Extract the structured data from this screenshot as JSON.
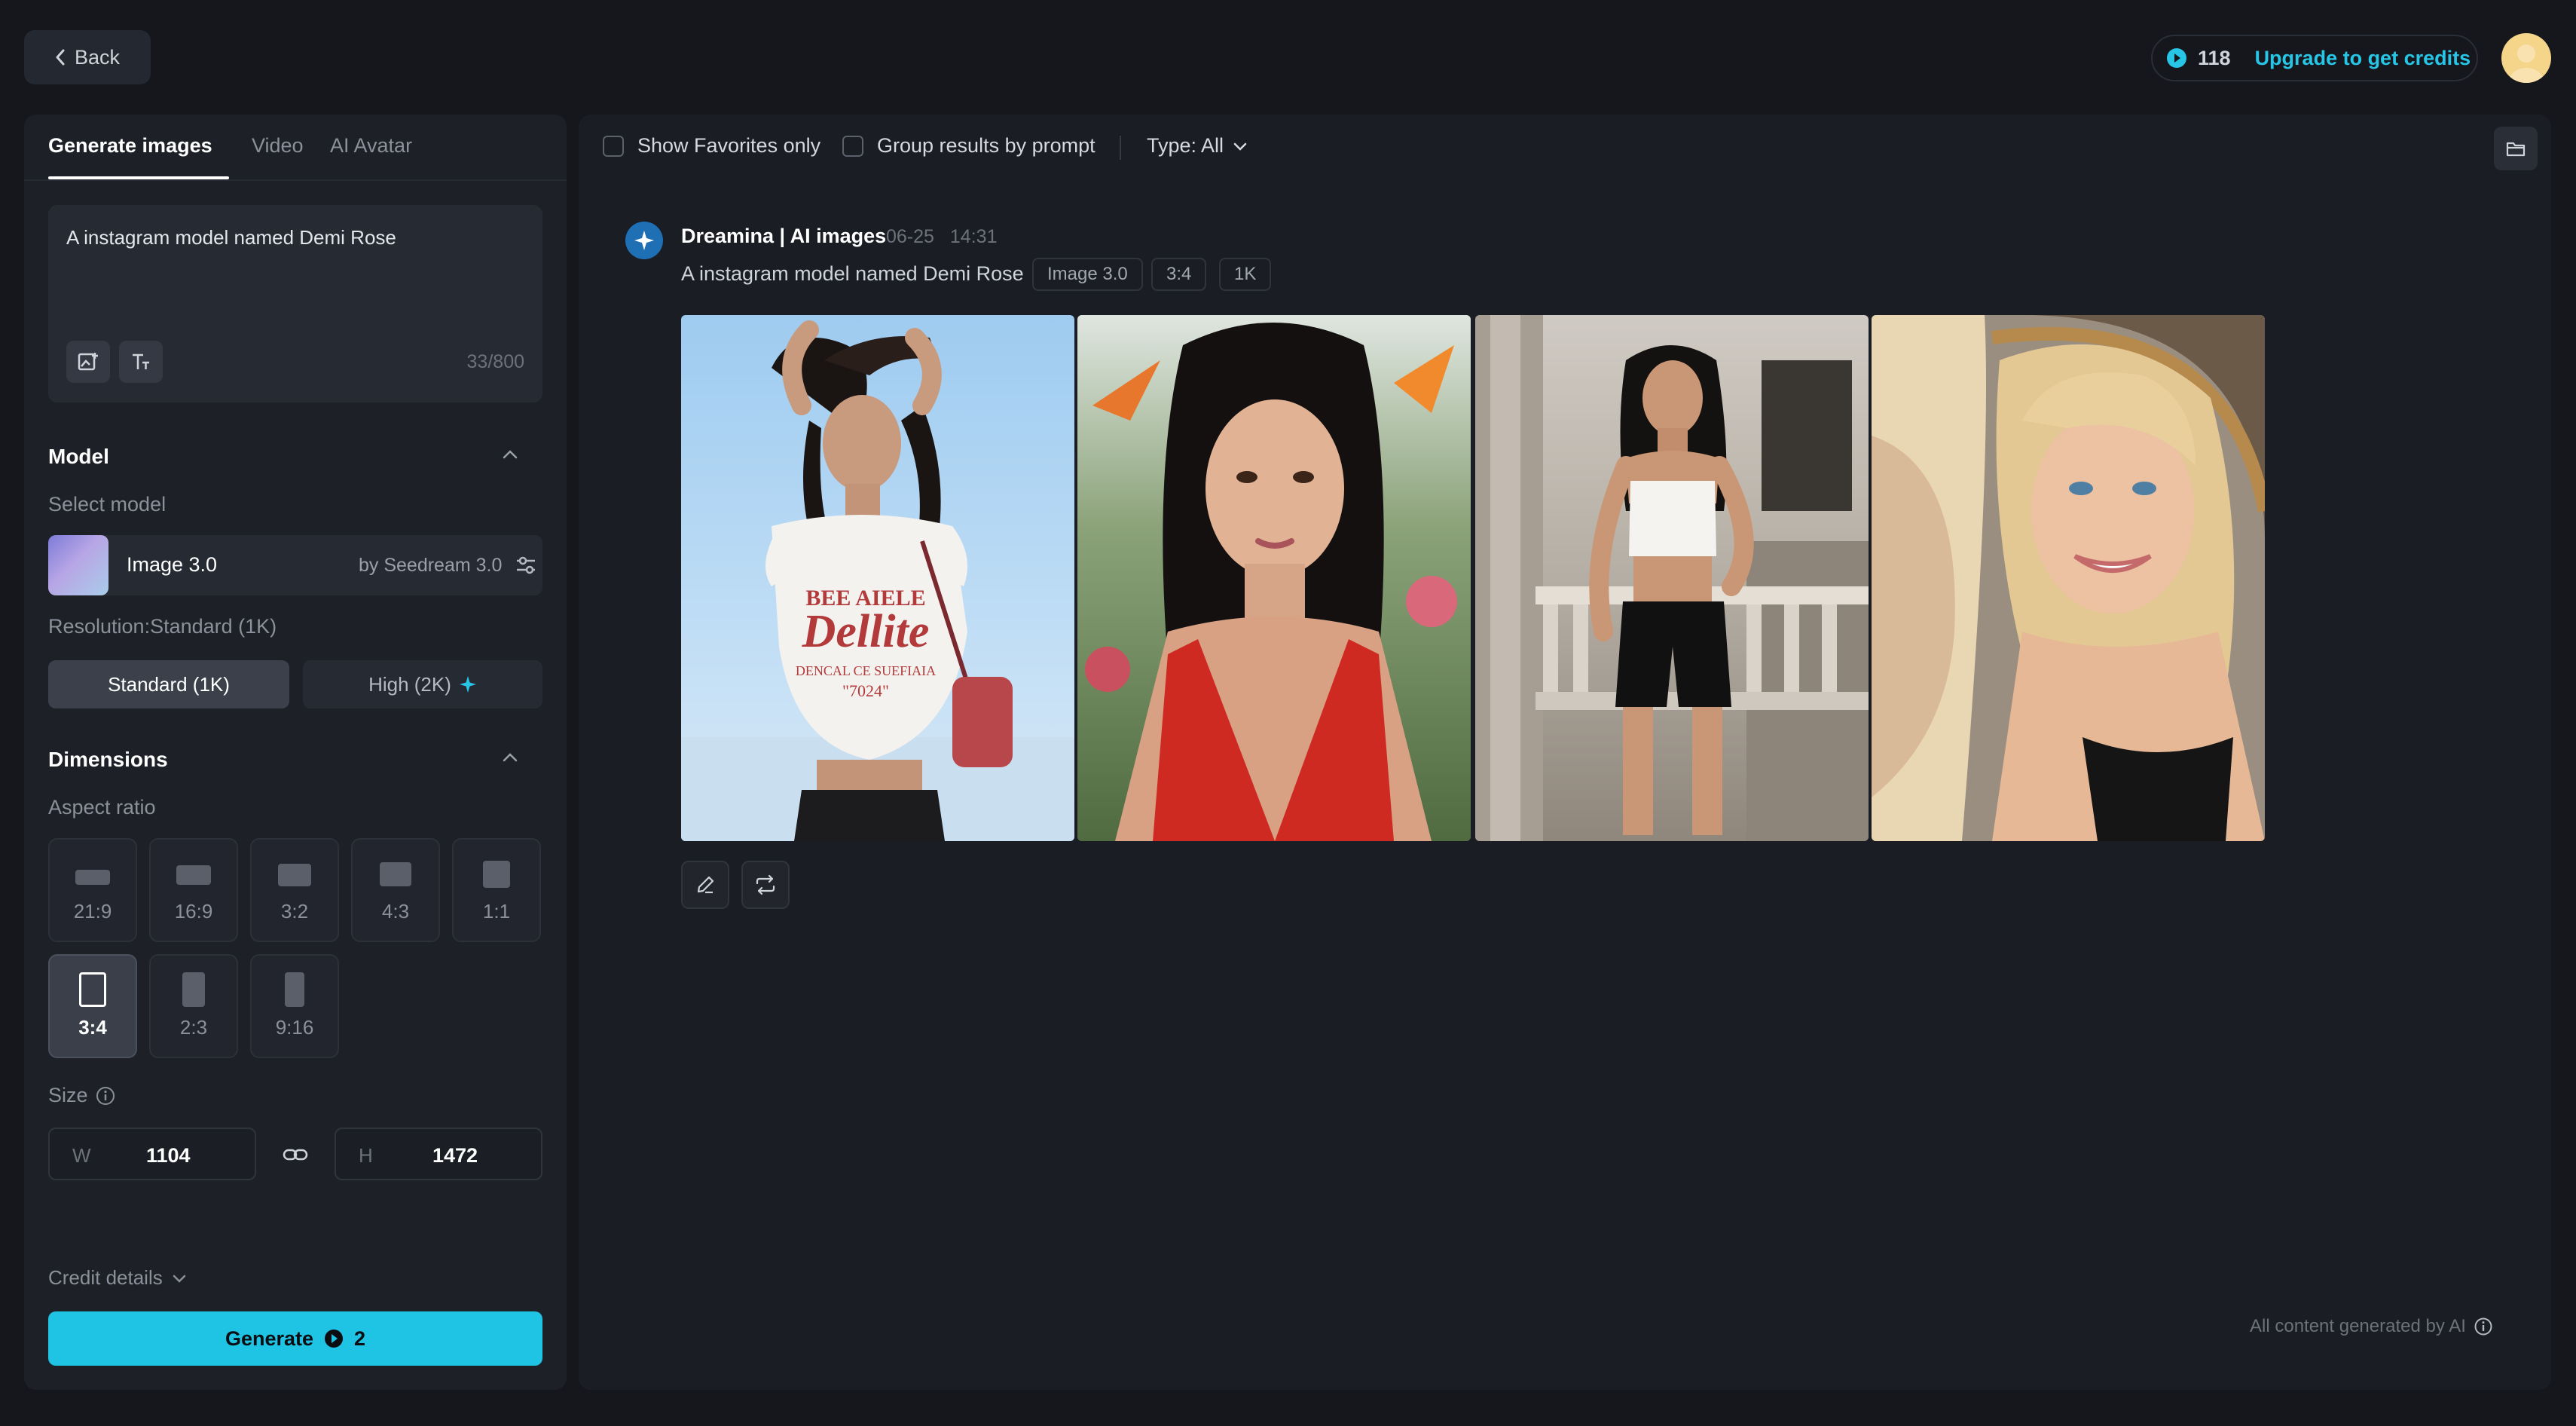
{
  "header": {
    "back_label": "Back",
    "credits": "118",
    "upgrade_label": "Upgrade to get credits"
  },
  "tabs": [
    {
      "label": "Generate images",
      "active": true
    },
    {
      "label": "Video",
      "active": false
    },
    {
      "label": "AI Avatar",
      "active": false
    }
  ],
  "prompt": {
    "text": "A instagram model named Demi Rose",
    "counter": "33/800"
  },
  "model": {
    "section_title": "Model",
    "select_label": "Select model",
    "name": "Image 3.0",
    "by": "by Seedream 3.0",
    "resolution_label": "Resolution:Standard (1K)",
    "standard_label": "Standard (1K)",
    "high_label": "High (2K)"
  },
  "dimensions": {
    "section_title": "Dimensions",
    "aspect_label": "Aspect ratio",
    "ratios": [
      "21:9",
      "16:9",
      "3:2",
      "4:3",
      "1:1",
      "3:4",
      "2:3",
      "9:16"
    ],
    "selected_ratio": "3:4",
    "size_label": "Size",
    "width_letter": "W",
    "width": "1104",
    "height_letter": "H",
    "height": "1472"
  },
  "footer": {
    "credit_details": "Credit details",
    "generate_label": "Generate",
    "generate_cost": "2"
  },
  "toolbar": {
    "favorites_label": "Show Favorites only",
    "group_label": "Group results by prompt",
    "type_label": "Type: All"
  },
  "result": {
    "title": "Dreamina | AI images",
    "date": "06-25",
    "time": "14:31",
    "prompt": "A instagram model named Demi Rose",
    "tags": [
      "Image 3.0",
      "3:4",
      "1K"
    ],
    "image_shirt_line1": "BEE AIELE",
    "image_shirt_line2": "Dellite",
    "image_shirt_line3": "DENCAL CE SUEFIAIA",
    "image_shirt_line4": "\"7024\""
  },
  "disclaimer": "All content generated by AI",
  "colors": {
    "accent": "#1fc3e3",
    "upgrade": "#27c6e6",
    "background": "#15171d",
    "panel": "#1d2027"
  }
}
